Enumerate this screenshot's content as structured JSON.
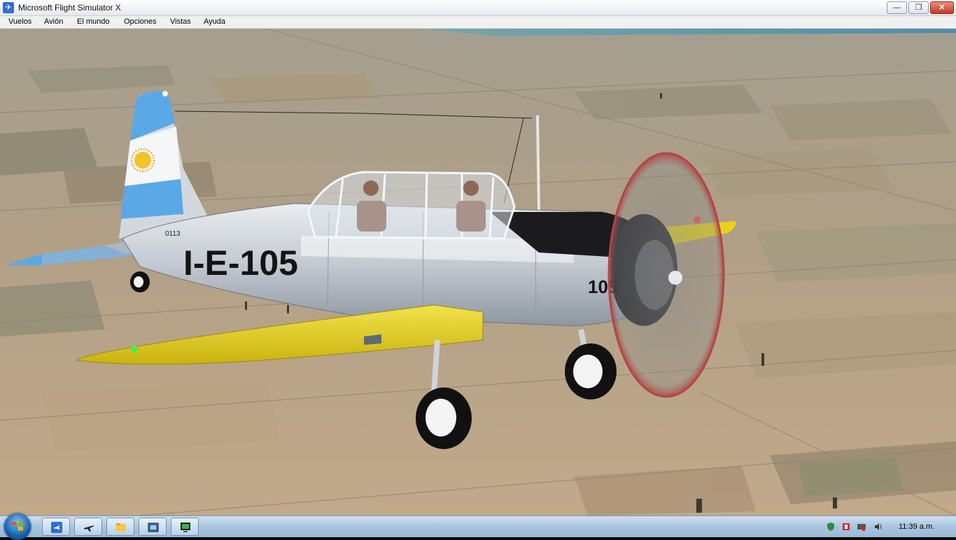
{
  "window": {
    "title": "Microsoft Flight Simulator X"
  },
  "menu": [
    "Vuelos",
    "Avión",
    "El mundo",
    "Opciones",
    "Vistas",
    "Ayuda"
  ],
  "aircraft": {
    "registration": "I-E-105",
    "nose_number": "105",
    "tail_code": "0113"
  },
  "taskbar": {
    "buttons": [
      "fsx-icon",
      "airplane-icon",
      "folder-icon",
      "screenshot-icon",
      "monitor-icon"
    ],
    "clock": "11:39 a.m."
  },
  "colors": {
    "accent_blue": "#2e6fd1",
    "flag_blue": "#5aa8e6",
    "wing_yellow": "#e8d31c",
    "fuselage_silver": "#c7ccd3"
  }
}
